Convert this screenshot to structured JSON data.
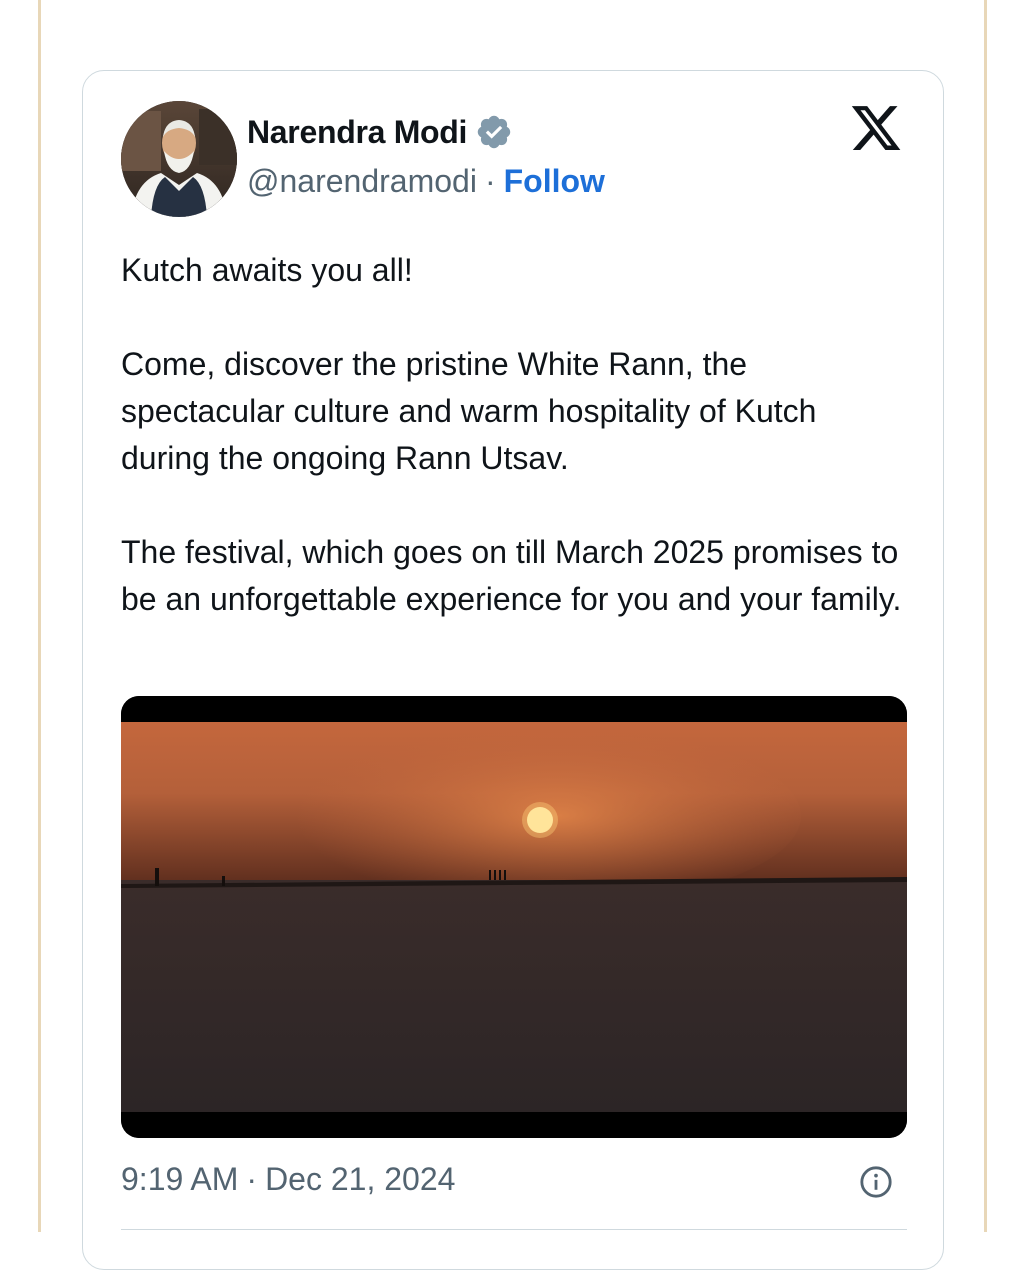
{
  "tweet": {
    "author_name": "Narendra Modi",
    "handle": "@narendramodi",
    "separator": "·",
    "follow_label": "Follow",
    "paragraphs": [
      "Kutch awaits you all!",
      "Come, discover the pristine White Rann, the spectacular culture and warm hospitality of Kutch during the ongoing Rann Utsav.",
      "The festival, which goes on till March 2025 promises to be an unforgettable experience for you and your family."
    ],
    "time": "9:19 AM",
    "date": "Dec 21, 2024"
  },
  "icons": {
    "verified": "verified-badge-icon",
    "platform": "x-logo-icon",
    "info": "info-icon"
  },
  "colors": {
    "follow": "#1d6fd8",
    "secondary_text": "#536471",
    "verified_badge": "#829aab",
    "border": "#cfd9de"
  }
}
